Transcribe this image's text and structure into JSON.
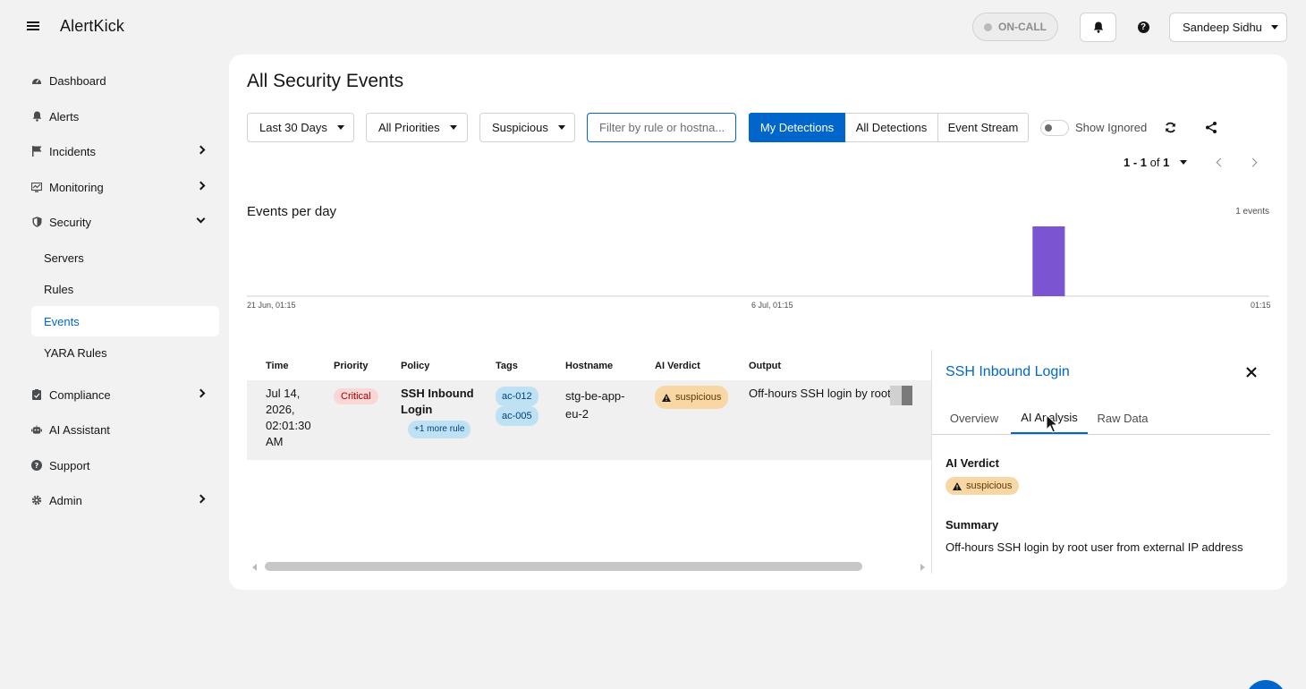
{
  "app": {
    "name": "AlertKick"
  },
  "header": {
    "oncall_label": "ON-CALL",
    "user_name": "Sandeep Sidhu",
    "help_glyph": "?"
  },
  "sidebar": {
    "items": [
      {
        "label": "Dashboard",
        "icon": "dashboard-icon"
      },
      {
        "label": "Alerts",
        "icon": "bell-icon"
      },
      {
        "label": "Incidents",
        "icon": "flag-icon"
      },
      {
        "label": "Monitoring",
        "icon": "monitor-icon"
      },
      {
        "label": "Security",
        "icon": "shield-icon"
      },
      {
        "label": "Compliance",
        "icon": "clipboard-icon"
      },
      {
        "label": "AI Assistant",
        "icon": "robot-icon"
      },
      {
        "label": "Support",
        "icon": "help-icon"
      },
      {
        "label": "Admin",
        "icon": "gear-icon"
      }
    ],
    "security_subitems": [
      "Servers",
      "Rules",
      "Events",
      "YARA Rules"
    ],
    "active_subitem": "Events"
  },
  "main": {
    "title": "All Security Events",
    "filters": {
      "date_range": "Last 30 Days",
      "priority": "All Priorities",
      "verdict": "Suspicious",
      "search_placeholder": "Filter by rule or hostna..."
    },
    "view_tabs": [
      "My Detections",
      "All Detections",
      "Event Stream"
    ],
    "active_view_tab": "My Detections",
    "show_ignored_label": "Show Ignored",
    "show_ignored": false,
    "pagination": {
      "range": "1 - 1",
      "of_label": "of",
      "total": "1"
    }
  },
  "chart_data": {
    "type": "bar",
    "title": "Events per day",
    "count_label": "1 events",
    "x_tick_labels": [
      "21 Jun, 01:15",
      "6 Jul, 01:15",
      "01:15"
    ],
    "categories": [
      "14 Jul"
    ],
    "values": [
      1
    ],
    "bar_color": "#7b55d1"
  },
  "table": {
    "columns": [
      "Time",
      "Priority",
      "Policy",
      "Tags",
      "Hostname",
      "AI Verdict",
      "Output"
    ],
    "rows": [
      {
        "time_lines": [
          "Jul 14,",
          "2026,",
          "02:01:30",
          "AM"
        ],
        "priority": "Critical",
        "policy_lines": [
          "SSH Inbound",
          "Login"
        ],
        "more_rules": "+1 more rule",
        "tags": [
          "ac-012",
          "ac-005"
        ],
        "hostname_lines": [
          "stg-be-app-",
          "eu-2"
        ],
        "verdict": "suspicious",
        "output": "Off-hours SSH login by root u"
      }
    ]
  },
  "detail_panel": {
    "title": "SSH Inbound Login",
    "tabs": [
      "Overview",
      "AI Analysis",
      "Raw Data"
    ],
    "active_tab": "AI Analysis",
    "verdict_label": "AI Verdict",
    "verdict": "suspicious",
    "summary_label": "Summary",
    "summary": "Off-hours SSH login by root user from external IP address"
  },
  "colors": {
    "accent": "#0066cc",
    "critical_bg": "#fbd6d6",
    "suspicious_bg": "#f9d7a4",
    "tag_bg": "#bee1f4"
  }
}
